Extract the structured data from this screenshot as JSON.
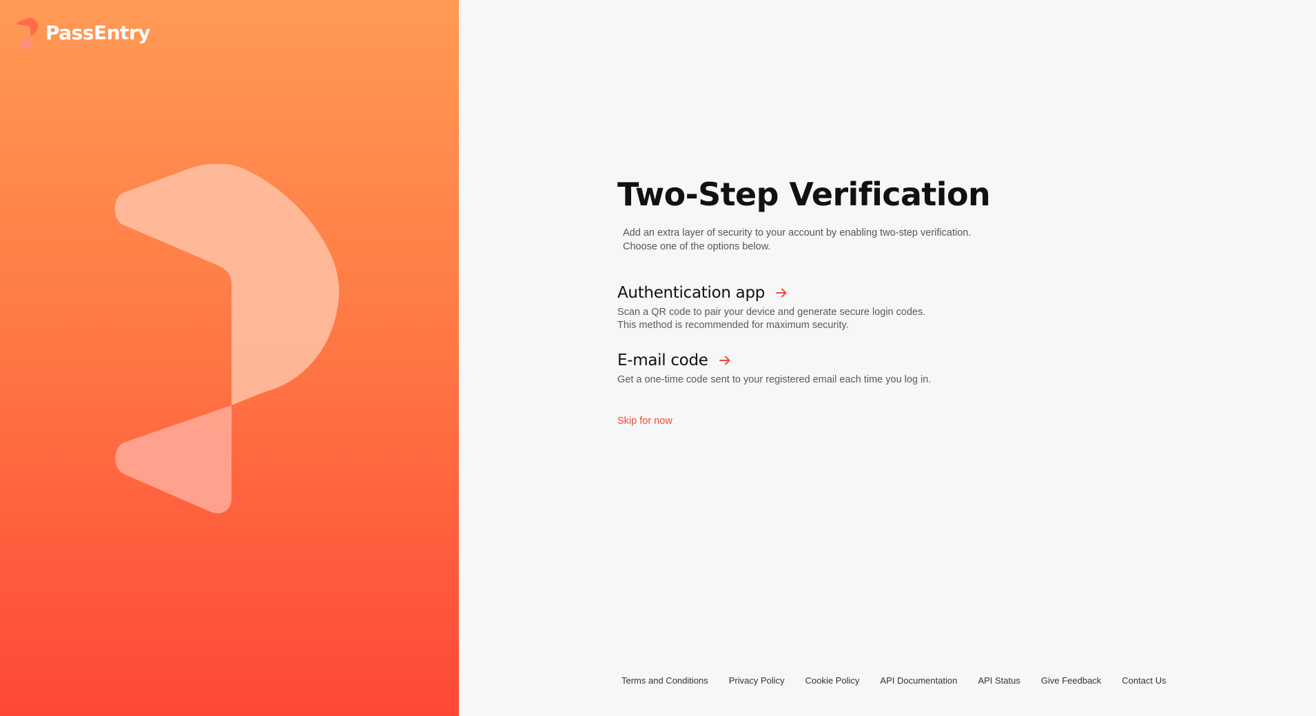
{
  "brand": {
    "name": "PassEntry",
    "logo_icon": "passentry-logo-icon",
    "gradient_top": "#ff9a55",
    "gradient_bottom": "#ff4836"
  },
  "main": {
    "title": "Two-Step Verification",
    "subtitle_lines": [
      "Add an extra layer of security to your account by enabling two-step verification.",
      "Choose one of the options below."
    ],
    "options": [
      {
        "title": "Authentication app",
        "icon": "arrow-right-icon",
        "description_lines": [
          "Scan a QR code to pair your device and generate secure login codes.",
          "This method is recommended for maximum security."
        ]
      },
      {
        "title": "E-mail code",
        "icon": "arrow-right-icon",
        "description_lines": [
          "Get a one-time code sent to your registered email each time you log in."
        ]
      }
    ],
    "skip_label": "Skip for now"
  },
  "footer": {
    "links": [
      "Terms and Conditions",
      "Privacy Policy",
      "Cookie Policy",
      "API Documentation",
      "API Status",
      "Give Feedback",
      "Contact Us"
    ]
  },
  "colors": {
    "accent": "#f04a38",
    "content_background": "#f7f7f7",
    "title_text": "#111111"
  }
}
